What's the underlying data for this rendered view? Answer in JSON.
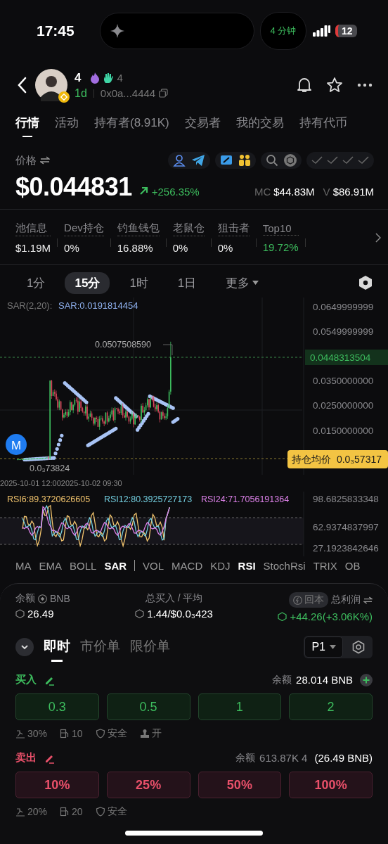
{
  "status_bar": {
    "time": "17:45",
    "live_activity": "4 分钟",
    "battery": "12"
  },
  "token": {
    "name": "4",
    "badge_count": "4",
    "age": "1d",
    "address": "0x0a...4444"
  },
  "tabs": [
    {
      "label": "行情",
      "selected": true
    },
    {
      "label": "活动",
      "selected": false
    },
    {
      "label": "持有者(8.91K)",
      "selected": false
    },
    {
      "label": "交易者",
      "selected": false
    },
    {
      "label": "我的交易",
      "selected": false
    },
    {
      "label": "持有代币",
      "selected": false
    }
  ],
  "price": {
    "label": "价格",
    "value": "$0.044831",
    "change": "+256.35%",
    "mc_label": "MC",
    "mc": "$44.83M",
    "v_label": "V",
    "volume": "$86.91M"
  },
  "stats": [
    {
      "label": "池信息",
      "value": "$1.19M",
      "highlight": false
    },
    {
      "label": "Dev持仓",
      "value": "0%",
      "highlight": false
    },
    {
      "label": "钓鱼钱包",
      "value": "16.88%",
      "highlight": false
    },
    {
      "label": "老鼠仓",
      "value": "0%",
      "highlight": false
    },
    {
      "label": "狙击者",
      "value": "0%",
      "highlight": false
    },
    {
      "label": "Top10",
      "value": "19.72%",
      "highlight": true
    }
  ],
  "timeframes": [
    {
      "label": "1分",
      "selected": false,
      "kind": "option"
    },
    {
      "label": "15分",
      "selected": true,
      "kind": "option"
    },
    {
      "label": "1时",
      "selected": false,
      "kind": "option"
    },
    {
      "label": "1日",
      "selected": false,
      "kind": "option"
    },
    {
      "label": "更多",
      "selected": false,
      "kind": "dropdown"
    }
  ],
  "price_chart": {
    "indicator_name": "SAR(2,20):",
    "indicator_value": "SAR:0.0191814454",
    "axis_labels": [
      "0.0649999999",
      "0.0549999999",
      "0.0350000000",
      "0.0250000000",
      "0.0150000000"
    ],
    "current_price": "0.0448313504",
    "high_label": "0.0507508590",
    "low_label": "0.0₃73824",
    "marker": "M",
    "avg_cost": {
      "label": "持仓均价",
      "value": "0.0₃57317"
    }
  },
  "dates": [
    "2025-10-01 12:00",
    "2025-10-02 09:30"
  ],
  "rsi": {
    "series": [
      {
        "label": "RSI6:89.3720626605",
        "color": "#f2c46d"
      },
      {
        "label": "RSI12:80.3925727173",
        "color": "#73cfe0"
      },
      {
        "label": "RSI24:71.7056191364",
        "color": "#de82ea"
      }
    ],
    "axis_labels": [
      "98.6825833348",
      "62.9374837997",
      "27.1923842646"
    ]
  },
  "main_indicators": [
    {
      "label": "MA",
      "selected": false
    },
    {
      "label": "EMA",
      "selected": false
    },
    {
      "label": "BOLL",
      "selected": false
    },
    {
      "label": "SAR",
      "selected": true
    }
  ],
  "sub_indicators": [
    {
      "label": "VOL",
      "selected": false
    },
    {
      "label": "MACD",
      "selected": false
    },
    {
      "label": "KDJ",
      "selected": false
    },
    {
      "label": "RSI",
      "selected": true
    },
    {
      "label": "StochRsi",
      "selected": false
    },
    {
      "label": "TRIX",
      "selected": false
    },
    {
      "label": "OB",
      "selected": false
    }
  ],
  "position": {
    "balance_label": "余额",
    "balance_unit": "BNB",
    "balance": "26.49",
    "bought_label": "总买入 / 平均",
    "bought": "1.44/$0.0₃423",
    "breakeven": "回本",
    "profit_label": "总利润",
    "profit": "+44.26(+3.06K%)"
  },
  "order_tabs": [
    {
      "label": "即时",
      "selected": true
    },
    {
      "label": "市价单",
      "selected": false
    },
    {
      "label": "限价单",
      "selected": false
    }
  ],
  "preset": "P1",
  "buy": {
    "label": "买入",
    "balance_label": "余额",
    "balance": "28.014 BNB",
    "amounts": [
      "0.3",
      "0.5",
      "1",
      "2"
    ],
    "settings": [
      {
        "kind": "slippage",
        "text": "30%"
      },
      {
        "kind": "gas",
        "text": "10"
      },
      {
        "kind": "safety",
        "text": "安全"
      },
      {
        "kind": "mev",
        "text": "开"
      }
    ]
  },
  "sell": {
    "label": "卖出",
    "balance_label": "余额",
    "balance": "613.87K 4",
    "balance_bnb": "(26.49 BNB)",
    "amounts": [
      "10%",
      "25%",
      "50%",
      "100%"
    ],
    "settings": [
      {
        "kind": "slippage",
        "text": "20%"
      },
      {
        "kind": "gas",
        "text": "20"
      },
      {
        "kind": "safety",
        "text": "安全"
      }
    ]
  }
}
